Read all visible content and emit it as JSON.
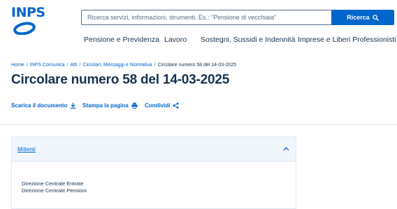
{
  "logo": {
    "text": "INPS"
  },
  "search": {
    "placeholder": "Ricerca servizi, informazioni, strumenti. Es.: \"Pensione di vecchiaia\"",
    "button_label": "Ricerca"
  },
  "nav": {
    "items": [
      {
        "label": "Pensione e Previdenza"
      },
      {
        "label": "Lavoro"
      },
      {
        "label": "Sostegni, Sussidi e Indennità"
      },
      {
        "label": "Imprese e Liberi Professionisti"
      }
    ]
  },
  "breadcrumb": {
    "items": [
      {
        "label": "Home"
      },
      {
        "label": "INPS Comunica"
      },
      {
        "label": "Atti"
      },
      {
        "label": "Circolari, Messaggi e Normativa"
      }
    ],
    "current": "Circolare numero 58 del 14-03-2025"
  },
  "page": {
    "title": "Circolare numero 58 del 14-03-2025"
  },
  "actions": {
    "download_label": "Scarica il documento",
    "print_label": "Stampa la pagina",
    "share_label": "Condividi"
  },
  "accordion": {
    "title": "Mittenti",
    "senders": [
      "Direzione Centrale Entrate",
      "Direzione Centrale Pensioni"
    ]
  },
  "colors": {
    "brand": "#0066cc",
    "text": "#17324d",
    "accordion_header_bg": "#f0f6fc"
  }
}
